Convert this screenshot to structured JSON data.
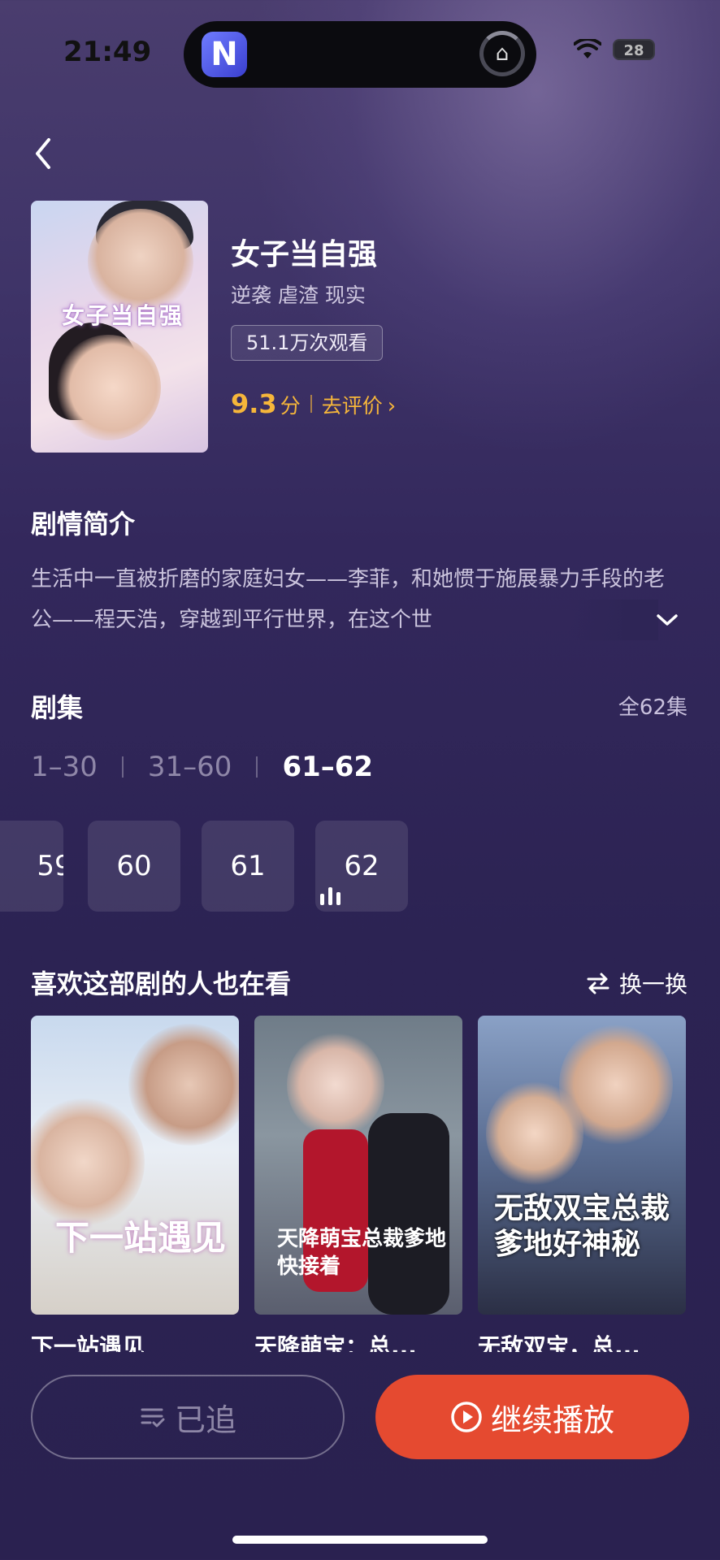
{
  "status_bar": {
    "time": "21:49",
    "battery": "28"
  },
  "island": {
    "app_letter": "N"
  },
  "show": {
    "cover_title": "女子当自强",
    "title": "女子当自强",
    "genres": "逆袭 虐渣 现实",
    "views": "51.1万次观看",
    "rating": "9.3",
    "rating_unit": "分",
    "rate_link": "去评价"
  },
  "synopsis": {
    "heading": "剧情简介",
    "text": "生活中一直被折磨的家庭妇女——李菲，和她惯于施展暴力手段的老公——程天浩，穿越到平行世界，在这个世"
  },
  "episodes": {
    "heading": "剧集",
    "total": "全62集",
    "ranges": [
      "1–30",
      "31–60",
      "61–62"
    ],
    "active_range_index": 2,
    "tiles": [
      "59",
      "60",
      "61",
      "62"
    ],
    "playing": "62"
  },
  "recommend": {
    "heading": "喜欢这部剧的人也在看",
    "shuffle_label": "换一换",
    "items": [
      {
        "poster_text": "下一站遇见",
        "caption": "下一站遇见"
      },
      {
        "poster_text": "天降萌宝总裁爹地快接着",
        "caption": "天降萌宝：总..."
      },
      {
        "poster_text": "无敌双宝总裁爹地好神秘",
        "caption": "无敌双宝，总..."
      }
    ]
  },
  "actions": {
    "follow": "已追",
    "play": "继续播放"
  },
  "colors": {
    "accent_play": "#e54a30",
    "rating": "#f6b63a",
    "background": "#2c2353"
  }
}
